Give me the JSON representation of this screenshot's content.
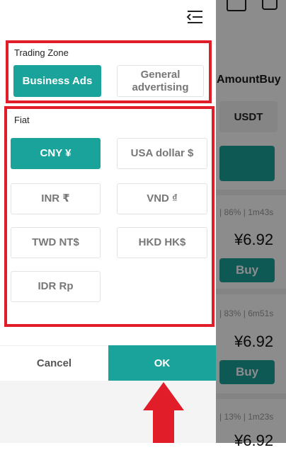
{
  "background": {
    "header_col_amount": "AmountBuy",
    "currency_chip": "USDT",
    "rows": [
      {
        "meta": "| 86% | 1m43s",
        "price": "¥6.92",
        "buy": "Buy"
      },
      {
        "meta": "| 83% | 6m51s",
        "price": "¥6.92",
        "buy": "Buy"
      },
      {
        "meta": "| 13% | 1m23s",
        "price": "¥6.92"
      }
    ]
  },
  "drawer": {
    "trading_zone": {
      "label": "Trading Zone",
      "options": [
        {
          "label": "Business Ads",
          "active": true
        },
        {
          "label": "General advertising",
          "active": false
        }
      ]
    },
    "fiat": {
      "label": "Fiat",
      "options": [
        {
          "label": "CNY ¥",
          "active": true
        },
        {
          "label": "USA dollar $",
          "active": false
        },
        {
          "label": "INR ₹",
          "active": false
        },
        {
          "label": "VND ₫",
          "active": false
        },
        {
          "label": "TWD NT$",
          "active": false
        },
        {
          "label": "HKD HK$",
          "active": false
        },
        {
          "label": "IDR Rp",
          "active": false
        }
      ]
    },
    "footer": {
      "cancel": "Cancel",
      "ok": "OK"
    }
  },
  "colors": {
    "accent": "#1aa39a",
    "highlight": "#e11d2a"
  },
  "icons": [
    "collapse-menu-icon",
    "up-arrow-icon"
  ]
}
